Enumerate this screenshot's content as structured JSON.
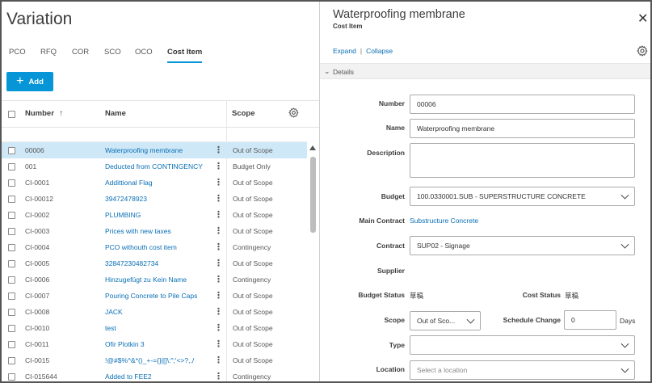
{
  "page": {
    "title": "Variation"
  },
  "tabs": [
    {
      "label": "PCO"
    },
    {
      "label": "RFQ"
    },
    {
      "label": "COR"
    },
    {
      "label": "SCO"
    },
    {
      "label": "OCO"
    },
    {
      "label": "Cost Item",
      "active": true
    }
  ],
  "toolbar": {
    "add_label": "Add"
  },
  "grid": {
    "columns": {
      "number": "Number",
      "name": "Name",
      "scope": "Scope"
    },
    "rows": [
      {
        "number": "00006",
        "name": "Waterproofing membrane",
        "scope": "Out of Scope",
        "selected": true
      },
      {
        "number": "001",
        "name": "Deducted from CONTINGENCY",
        "scope": "Budget Only"
      },
      {
        "number": "CI-0001",
        "name": "Addittional Flag",
        "scope": "Out of Scope"
      },
      {
        "number": "CI-00012",
        "name": "39472478923",
        "scope": "Out of Scope"
      },
      {
        "number": "CI-0002",
        "name": "PLUMBING",
        "scope": "Out of Scope"
      },
      {
        "number": "CI-0003",
        "name": "Prices with new taxes",
        "scope": "Out of Scope"
      },
      {
        "number": "CI-0004",
        "name": "PCO withouth cost item",
        "scope": "Contingency"
      },
      {
        "number": "CI-0005",
        "name": "32847230482734",
        "scope": "Out of Scope"
      },
      {
        "number": "CI-0006",
        "name": "Hinzugefügt zu Kein Name",
        "scope": "Contingency"
      },
      {
        "number": "CI-0007",
        "name": "Pouring Concrete to Pile Caps",
        "scope": "Out of Scope"
      },
      {
        "number": "CI-0008",
        "name": "JACK",
        "scope": "Out of Scope"
      },
      {
        "number": "CI-0010",
        "name": "test",
        "scope": "Out of Scope"
      },
      {
        "number": "CI-0011",
        "name": "Ofir Plotkin 3",
        "scope": "Out of Scope"
      },
      {
        "number": "CI-0015",
        "name": "!@#$%^&*()_+-={}|[]\\:\";'<>?,./",
        "scope": "Out of Scope"
      },
      {
        "number": "CI-015644",
        "name": "Added to FEE2",
        "scope": "Contingency"
      }
    ]
  },
  "detail": {
    "title": "Waterproofing membrane",
    "subtitle": "Cost Item",
    "expand_label": "Expand",
    "separator": "|",
    "collapse_label": "Collapse",
    "section_label": "Details",
    "fields": {
      "number": {
        "label": "Number",
        "value": "00006"
      },
      "name": {
        "label": "Name",
        "value": "Waterproofing membrane"
      },
      "description": {
        "label": "Description",
        "value": ""
      },
      "budget": {
        "label": "Budget",
        "value": "100.0330001.SUB - SUPERSTRUCTURE CONCRETE"
      },
      "main_contract": {
        "label": "Main Contract",
        "value": "Substructure Concrete"
      },
      "contract": {
        "label": "Contract",
        "value": "SUP02 - Signage"
      },
      "supplier": {
        "label": "Supplier",
        "value": ""
      },
      "budget_status": {
        "label": "Budget Status",
        "value": "草稿"
      },
      "cost_status": {
        "label": "Cost Status",
        "value": "草稿"
      },
      "scope": {
        "label": "Scope",
        "value": "Out of Sco..."
      },
      "schedule_change": {
        "label": "Schedule Change",
        "value": "0",
        "unit": "Days"
      },
      "type": {
        "label": "Type",
        "value": ""
      },
      "location": {
        "label": "Location",
        "placeholder": "Select a location"
      }
    }
  },
  "colors": {
    "accent": "#0696d7",
    "link": "#0a6fb5",
    "selected_row": "#cfe8f7"
  }
}
